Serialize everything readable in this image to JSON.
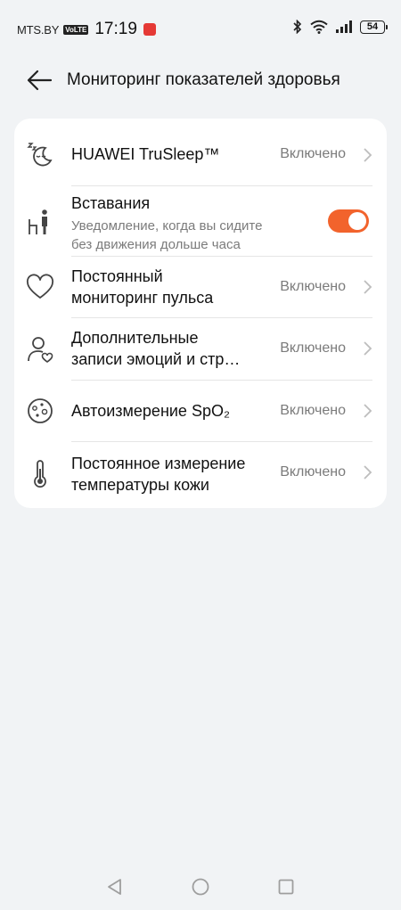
{
  "status_bar": {
    "carrier": "MTS.BY",
    "volte": "VoLTE",
    "time": "17:19",
    "battery": "54"
  },
  "header": {
    "title": "Мониторинг показателей здоровья"
  },
  "settings": [
    {
      "icon": "sleep-icon",
      "title": "HUAWEI TruSleep™",
      "value": "Включено"
    },
    {
      "icon": "standing-person-icon",
      "title": "Вставания",
      "subtitle_line1": "Уведомление, когда вы сидите",
      "subtitle_line2": "без движения дольше часа",
      "toggle_on": true
    },
    {
      "icon": "heart-icon",
      "title_line1": "Постоянный",
      "title_line2": "мониторинг пульса",
      "value": "Включено"
    },
    {
      "icon": "emotion-person-icon",
      "title_line1": "Дополнительные",
      "title_line2": "записи эмоций и стр…",
      "value": "Включено"
    },
    {
      "icon": "spo2-icon",
      "title": "Автоизмерение SpO₂",
      "value": "Включено"
    },
    {
      "icon": "thermometer-icon",
      "title_line1": "Постоянное измерение",
      "title_line2": "температуры кожи",
      "value": "Включено"
    }
  ],
  "colors": {
    "accent": "#f2632c",
    "background": "#f1f3f5",
    "card": "#ffffff"
  }
}
